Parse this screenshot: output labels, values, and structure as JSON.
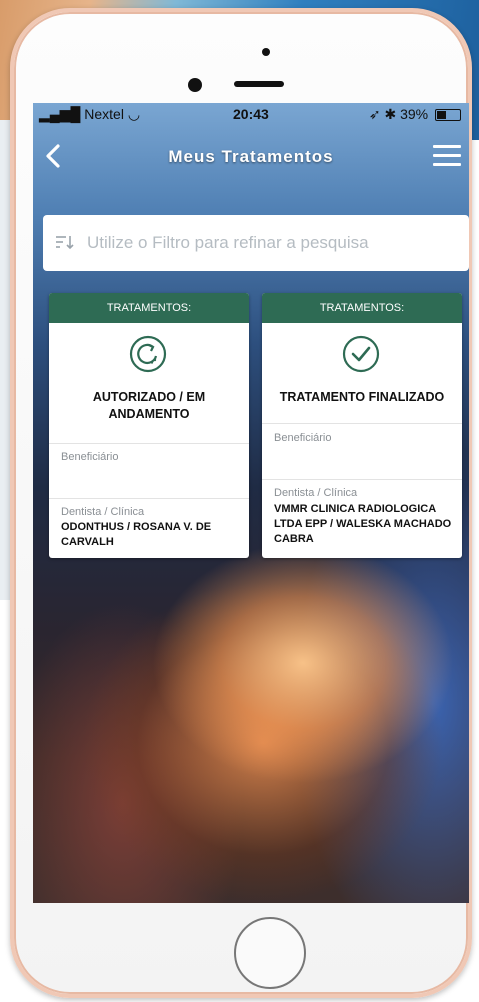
{
  "status_bar": {
    "carrier": "Nextel",
    "time": "20:43",
    "battery": "39%"
  },
  "nav": {
    "title": "Meus Tratamentos"
  },
  "search": {
    "placeholder": "Utilize o Filtro para refinar a pesquisa"
  },
  "cards": [
    {
      "header": "TRATAMENTOS:",
      "status": "AUTORIZADO / EM ANDAMENTO",
      "icon": "refresh-icon",
      "beneficiary_label": "Beneficiário",
      "beneficiary_value": "",
      "dentist_label": "Dentista / Clínica",
      "dentist_value": "ODONTHUS / ROSANA V. DE CARVALH"
    },
    {
      "header": "TRATAMENTOS:",
      "status": "TRATAMENTO FINALIZADO",
      "icon": "check-circle-icon",
      "beneficiary_label": "Beneficiário",
      "beneficiary_value": "",
      "dentist_label": "Dentista / Clínica",
      "dentist_value": "VMMR CLINICA RADIOLOGICA LTDA EPP / WALESKA MACHADO CABRA"
    }
  ],
  "colors": {
    "card_header": "#2e6b54",
    "icon_color": "#2e6b54"
  }
}
